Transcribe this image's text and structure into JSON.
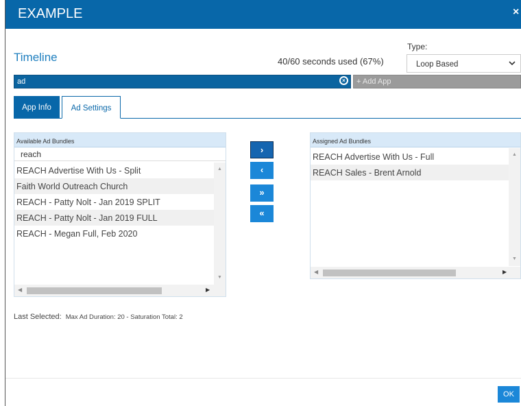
{
  "window": {
    "title": "EXAMPLE",
    "close_label": "×"
  },
  "timeline": {
    "heading": "Timeline",
    "seconds_used": "40/60 seconds used (67%)",
    "type_label": "Type:",
    "type_value": "Loop Based"
  },
  "search": {
    "value": "ad",
    "add_app_label": "+ Add App"
  },
  "tabs": [
    {
      "label": "App Info",
      "active": false
    },
    {
      "label": "Ad Settings",
      "active": true
    }
  ],
  "available": {
    "header": "Available Ad Bundles",
    "filter_value": "reach",
    "items": [
      "REACH Advertise With Us - Split",
      "Faith World Outreach Church",
      "REACH - Patty Nolt - Jan 2019 SPLIT",
      "REACH - Patty Nolt - Jan 2019 FULL",
      "REACH - Megan Full, Feb 2020"
    ]
  },
  "assigned": {
    "header": "Assigned Ad Bundles",
    "items": [
      "REACH Advertise With Us - Full",
      "REACH Sales - Brent Arnold"
    ]
  },
  "move_buttons": {
    "move_right": "›",
    "move_left": "‹",
    "move_all_right": "»",
    "move_all_left": "«"
  },
  "last_selected": {
    "label": "Last Selected:",
    "detail": "Max Ad Duration: 20 - Saturation Total: 2"
  },
  "footer": {
    "ok_label": "OK"
  },
  "colors": {
    "brand": "#0867a9",
    "button": "#1b87d8",
    "header_bg": "#d8e9f8"
  },
  "icons": [
    "close-icon",
    "clear-circle-icon",
    "chevron-down-icon",
    "chevron-right-icon",
    "chevron-left-icon",
    "double-chevron-right-icon",
    "double-chevron-left-icon"
  ]
}
